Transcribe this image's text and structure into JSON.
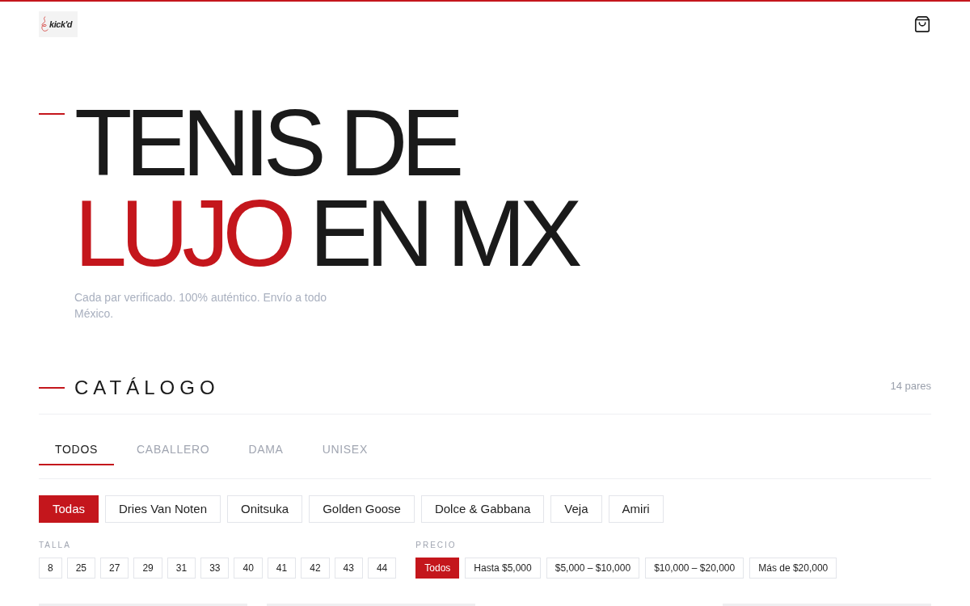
{
  "header": {
    "logo": {
      "text": "kick'd"
    }
  },
  "hero": {
    "title_lines": [
      {
        "parts": [
          {
            "text": "TENIS DE",
            "accent": false
          }
        ]
      },
      {
        "parts": [
          {
            "text": "LUJO",
            "accent": true
          },
          {
            "text": "EN MX",
            "accent": false
          }
        ]
      }
    ],
    "subtitle": "Cada par verificado. 100% auténtico. Envío a todo México."
  },
  "catalog": {
    "title": "CATÁLOGO",
    "count": "14 pares",
    "tabs": [
      {
        "label": "TODOS",
        "selected": true
      },
      {
        "label": "CABALLERO",
        "selected": false
      },
      {
        "label": "DAMA",
        "selected": false
      },
      {
        "label": "UNISEX",
        "selected": false
      }
    ],
    "brands": [
      {
        "label": "Todas",
        "selected": true
      },
      {
        "label": "Dries Van Noten",
        "selected": false
      },
      {
        "label": "Onitsuka",
        "selected": false
      },
      {
        "label": "Golden Goose",
        "selected": false
      },
      {
        "label": "Dolce & Gabbana",
        "selected": false
      },
      {
        "label": "Veja",
        "selected": false
      },
      {
        "label": "Amiri",
        "selected": false
      }
    ],
    "size_filter": {
      "label": "TALLA",
      "options": [
        {
          "label": "8",
          "selected": false
        },
        {
          "label": "25",
          "selected": false
        },
        {
          "label": "27",
          "selected": false
        },
        {
          "label": "29",
          "selected": false
        },
        {
          "label": "31",
          "selected": false
        },
        {
          "label": "33",
          "selected": false
        },
        {
          "label": "40",
          "selected": false
        },
        {
          "label": "41",
          "selected": false
        },
        {
          "label": "42",
          "selected": false
        },
        {
          "label": "43",
          "selected": false
        },
        {
          "label": "44",
          "selected": false
        }
      ]
    },
    "price_filter": {
      "label": "PRECIO",
      "options": [
        {
          "label": "Todos",
          "selected": true
        },
        {
          "label": "Hasta $5,000",
          "selected": false
        },
        {
          "label": "$5,000 – $10,000",
          "selected": false
        },
        {
          "label": "$10,000 – $20,000",
          "selected": false
        },
        {
          "label": "Más de $20,000",
          "selected": false
        }
      ]
    }
  }
}
